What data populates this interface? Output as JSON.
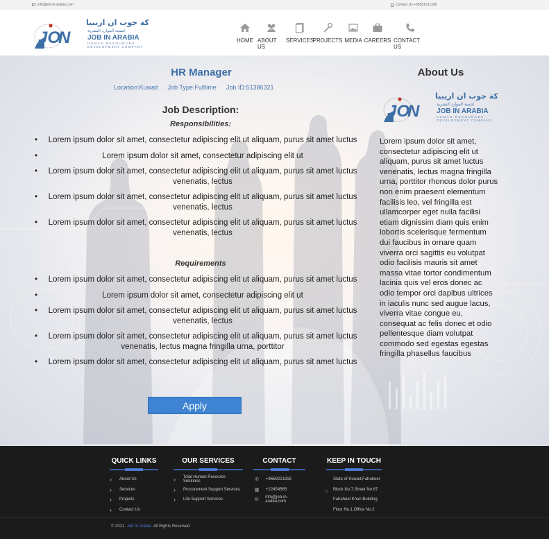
{
  "topbar": {
    "email": "info@job-in-arabia.com",
    "contact": "Contact Us +96551221280"
  },
  "brand": {
    "arabic_name": "شركة جوب ان اريبيا",
    "arabic_tagline": "لتنمية الموارد البشرية",
    "name": "JOB IN ARABIA",
    "tagline1": "HUMAN RESOURCES",
    "tagline2": "DEVELOPMENT COMPANY",
    "accent": "#3d6fa7"
  },
  "nav": [
    {
      "label": "HOME",
      "icon": "home-icon"
    },
    {
      "label": "ABOUT US",
      "icon": "users-icon"
    },
    {
      "label": "SERVICES",
      "icon": "document-icon"
    },
    {
      "label": "PROJECTS",
      "icon": "wrench-icon"
    },
    {
      "label": "MEDIA",
      "icon": "image-icon"
    },
    {
      "label": "CAREERS",
      "icon": "briefcase-icon"
    },
    {
      "label": "CONTACT US",
      "icon": "phone-icon"
    }
  ],
  "job": {
    "title": "HR Manager",
    "location": "Location:Kuwait",
    "type": "Job Type:Fulltime",
    "id": "Job ID:51386321",
    "description_heading": "Job Description:",
    "responsibilities_heading": "Responsibilities:",
    "responsibilities": [
      "Lorem ipsum dolor sit amet, consectetur adipiscing elit ut aliquam, purus sit amet luctus",
      "Lorem ipsum dolor sit amet, consectetur adipiscing elit ut",
      "Lorem ipsum dolor sit amet, consectetur adipiscing elit ut aliquam, purus sit amet luctus venenatis, lectus",
      "Lorem ipsum dolor sit amet, consectetur adipiscing elit ut aliquam, purus sit amet luctus venenatis, lectus",
      "Lorem ipsum dolor sit amet, consectetur adipiscing elit ut aliquam, purus sit amet luctus venenatis, lectus"
    ],
    "requirements_heading": "Requirements",
    "requirements": [
      "Lorem ipsum dolor sit amet, consectetur adipiscing elit ut aliquam, purus sit amet luctus",
      "Lorem ipsum dolor sit amet, consectetur adipiscing elit ut",
      "Lorem ipsum dolor sit amet, consectetur adipiscing elit ut aliquam, purus sit amet luctus venenatis, lectus",
      "Lorem ipsum dolor sit amet, consectetur adipiscing elit ut aliquam, purus sit amet luctus venenatis, lectus magna fringilla urna, porttitor",
      "Lorem ipsum dolor sit amet, consectetur adipiscing elit ut aliquam, purus sit amet luctus"
    ],
    "apply_label": "Apply",
    "apply_color": "#3e84d2"
  },
  "about": {
    "title": "About Us",
    "text": "Lorem ipsum dolor sit amet, consectetur adipiscing elit ut aliquam, purus sit amet luctus venenatis, lectus magna fringilla urna, porttitor rhoncus dolor purus non enim praesent elementum facilisis leo, vel fringilla est ullamcorper eget nulla facilisi etiam dignissim diam quis enim lobortis scelerisque fermentum dui faucibus in ornare quam viverra orci sagittis eu volutpat odio facilisis mauris sit amet massa vitae tortor condimentum lacinia quis vel eros donec ac odio tempor orci dapibus ultrices in iaculis nunc sed augue lacus, viverra vitae congue eu, consequat ac felis donec et odio pellentesque diam volutpat commodo sed egestas egestas fringilla phasellus faucibus"
  },
  "footer": {
    "quick_links": {
      "heading": "QUICK LINKS",
      "items": [
        "About Us",
        "Services",
        "Projects",
        "Contact Us"
      ]
    },
    "services": {
      "heading": "OUR SERVICES",
      "items": [
        "Total Human Resource Solutions",
        "Procurement Support Services",
        "Life Support Services"
      ]
    },
    "contact": {
      "heading": "CONTACT",
      "phone": "+9659221818",
      "fax": "+22454565",
      "email": "info@job-in-arabia.com"
    },
    "keep_in_touch": {
      "heading": "KEEP IN TOUCH",
      "address": [
        "State of Kuwait,Fahaheel",
        "Block No.7,Street No.67",
        "Fahaheel Khan Building",
        "Floor No.1,Office No.2"
      ]
    },
    "copyright_year": "© 2021",
    "copyright_brand": "Job In Arabia",
    "copyright_rest": "All Rights Reserved"
  }
}
